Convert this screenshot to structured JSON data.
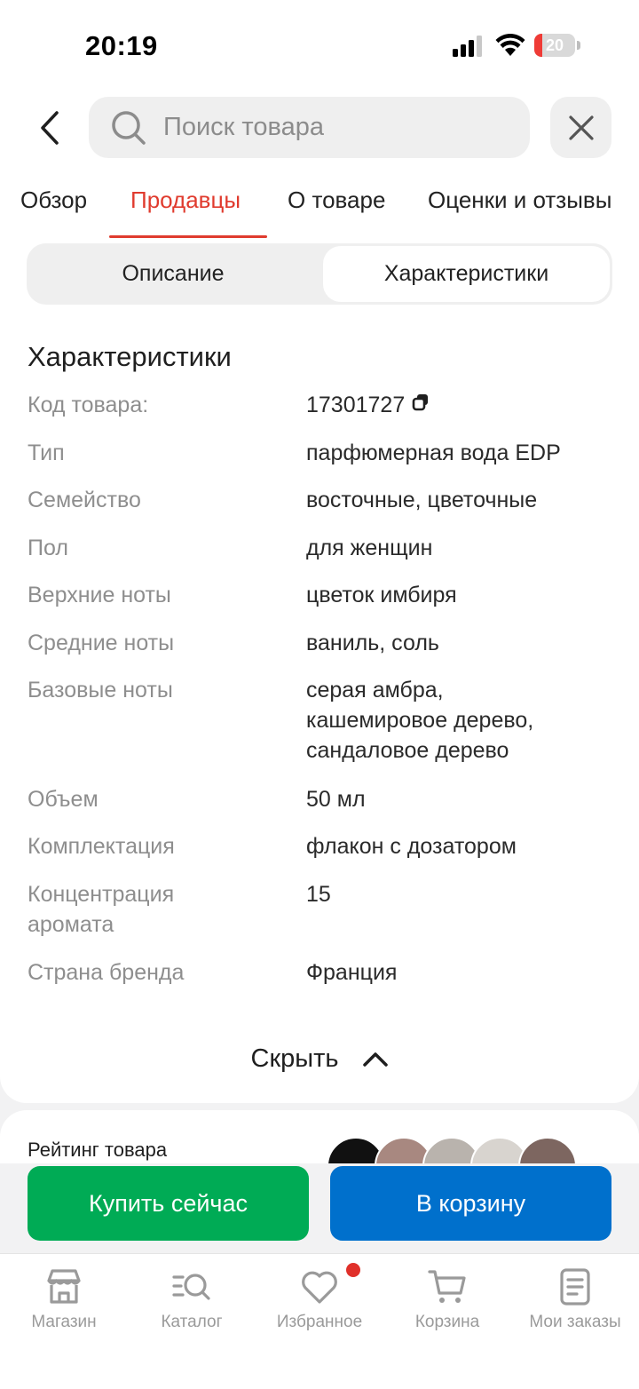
{
  "status_bar": {
    "time": "20:19",
    "battery": "20",
    "battery_percent": 20
  },
  "header": {
    "search_placeholder": "Поиск товара",
    "tabs": [
      {
        "label": "Обзор"
      },
      {
        "label": "Продавцы"
      },
      {
        "label": "О товаре"
      },
      {
        "label": "Оценки и отзывы"
      }
    ]
  },
  "segmented": {
    "description": "Описание",
    "characteristics": "Характеристики"
  },
  "specs": {
    "title": "Характеристики",
    "rows": [
      {
        "label": "Код товара:",
        "value": "17301727"
      },
      {
        "label": "Тип",
        "value": "парфюмерная вода EDP"
      },
      {
        "label": "Семейство",
        "value": "восточные, цветочные"
      },
      {
        "label": "Пол",
        "value": "для женщин"
      },
      {
        "label": "Верхние ноты",
        "value": "цветок имбиря"
      },
      {
        "label": "Средние ноты",
        "value": "ваниль, соль"
      },
      {
        "label": "Базовые ноты",
        "value": "серая амбра, кашемировое дерево, сандаловое дерево"
      },
      {
        "label": "Объем",
        "value": "50 мл"
      },
      {
        "label": "Комплектация",
        "value": "флакон с дозатором"
      },
      {
        "label": "Концентрация аромата",
        "value": "15"
      },
      {
        "label": "Страна бренда",
        "value": "Франция"
      }
    ],
    "collapse_label": "Скрыть"
  },
  "rating": {
    "label": "Рейтинг товара"
  },
  "actions": {
    "buy_now": "Купить сейчас",
    "add_to_cart": "В корзину"
  },
  "nav": [
    {
      "label": "Магазин",
      "icon": "store-icon"
    },
    {
      "label": "Каталог",
      "icon": "catalog-search-icon"
    },
    {
      "label": "Избранное",
      "icon": "heart-icon"
    },
    {
      "label": "Корзина",
      "icon": "cart-icon"
    },
    {
      "label": "Мои заказы",
      "icon": "orders-icon"
    }
  ],
  "colors": {
    "accent": "#e03b2e",
    "buy_green": "#00ab55",
    "cart_blue": "#0070cc"
  }
}
